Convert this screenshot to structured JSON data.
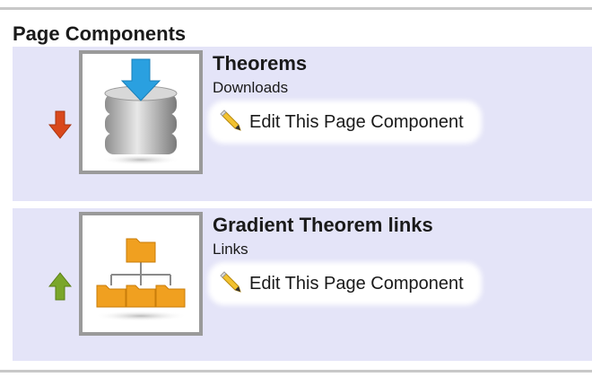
{
  "section": {
    "title": "Page Components"
  },
  "components": [
    {
      "title": "Theorems",
      "type": "Downloads",
      "edit_label": "Edit This Page Component",
      "move_direction": "down",
      "move_color": "#d9481c",
      "icon": "database-download-icon"
    },
    {
      "title": "Gradient Theorem links",
      "type": "Links",
      "edit_label": "Edit This Page Component",
      "move_direction": "up",
      "move_color": "#7aa62a",
      "icon": "folder-tree-icon"
    }
  ],
  "colors": {
    "row_background": "#e4e4f8",
    "thumb_border": "#9a9a9a",
    "folder_orange": "#f0a020",
    "download_blue": "#2aa0e0"
  }
}
